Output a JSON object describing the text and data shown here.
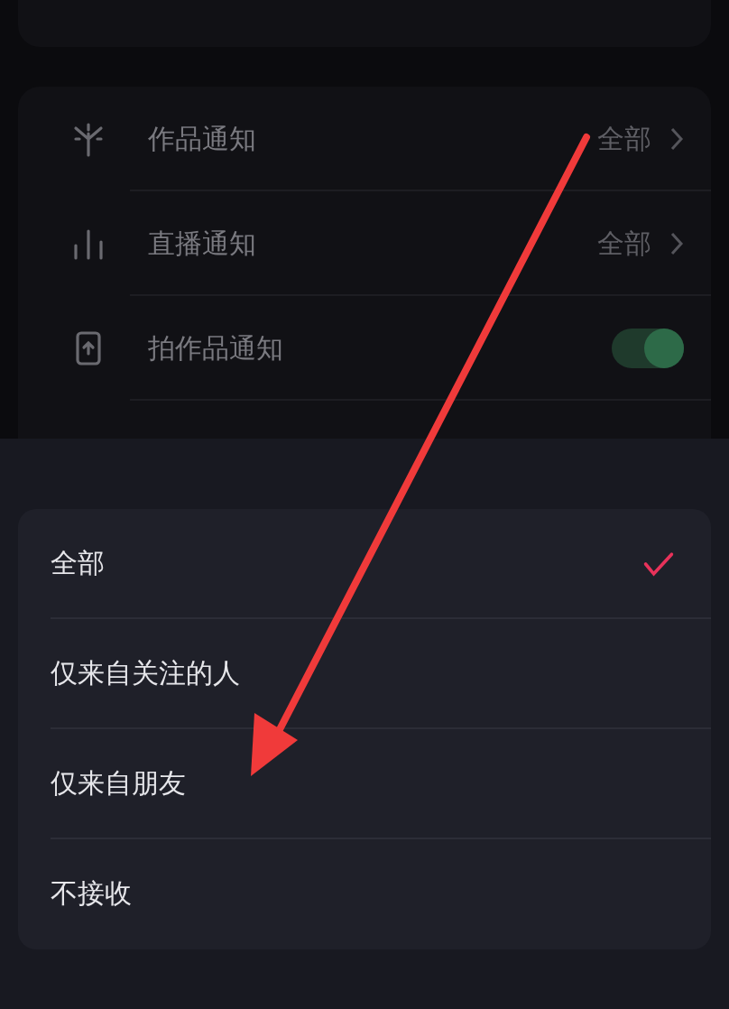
{
  "settings": [
    {
      "kind": "select",
      "label": "作品通知",
      "value": "全部"
    },
    {
      "kind": "select",
      "label": "直播通知",
      "value": "全部"
    },
    {
      "kind": "toggle",
      "label": "拍作品通知",
      "on": true
    }
  ],
  "sheet": {
    "options": [
      {
        "label": "全部",
        "selected": true
      },
      {
        "label": "仅来自关注的人",
        "selected": false
      },
      {
        "label": "仅来自朋友",
        "selected": false
      },
      {
        "label": "不接收",
        "selected": false
      }
    ]
  }
}
